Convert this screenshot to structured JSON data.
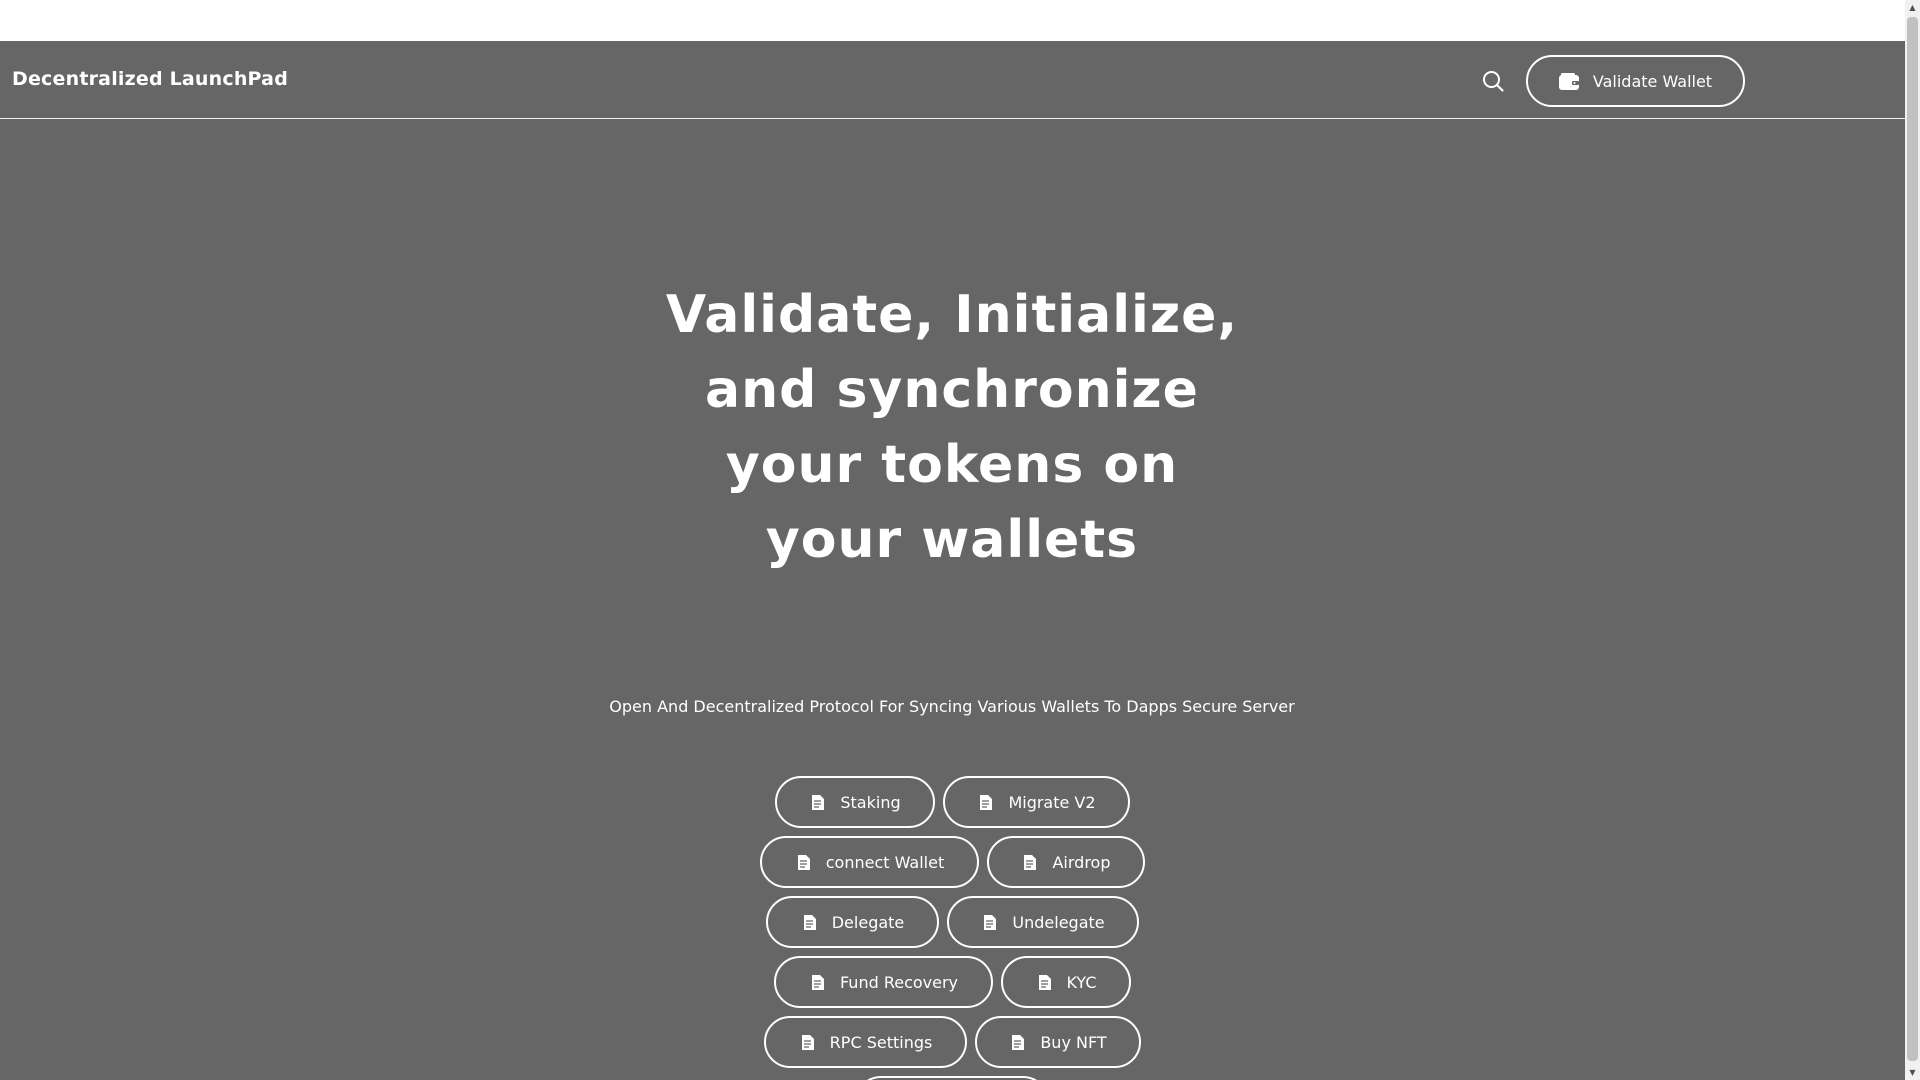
{
  "header": {
    "brand": "Decentralized LaunchPad",
    "search_icon": "search-icon",
    "wallet_button_label": "Validate Wallet",
    "wallet_icon": "wallet-icon"
  },
  "hero": {
    "title": "Validate, Initialize, and synchronize your tokens on your wallets",
    "subtitle": "Open And Decentralized Protocol For Syncing Various Wallets To Dapps Secure Server"
  },
  "actions": [
    {
      "label": "Staking",
      "icon": "document-icon"
    },
    {
      "label": "Migrate V2",
      "icon": "document-icon"
    },
    {
      "label": "connect Wallet",
      "icon": "document-icon"
    },
    {
      "label": "Airdrop",
      "icon": "document-icon"
    },
    {
      "label": "Delegate",
      "icon": "document-icon"
    },
    {
      "label": "Undelegate",
      "icon": "document-icon"
    },
    {
      "label": "Fund Recovery",
      "icon": "document-icon"
    },
    {
      "label": "KYC",
      "icon": "document-icon"
    },
    {
      "label": "RPC Settings",
      "icon": "document-icon"
    },
    {
      "label": "Buy NFT",
      "icon": "document-icon"
    }
  ],
  "colors": {
    "page_background": "#666666",
    "text": "#ffffff",
    "button_border": "#ffffff"
  }
}
